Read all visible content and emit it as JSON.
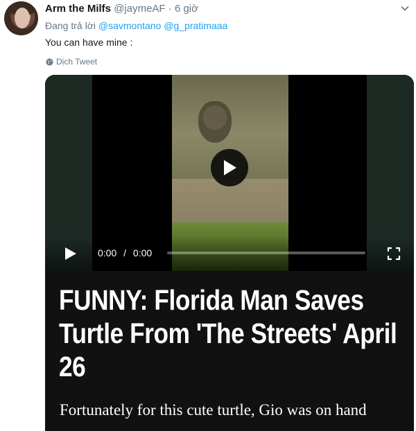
{
  "tweet": {
    "display_name": "Arm the Milfs",
    "handle": "@jaymeAF",
    "separator": "·",
    "time": "6 giờ",
    "reply_prefix": "Đang trả lời",
    "mentions": [
      "@savmontano",
      "@g_pratimaaa"
    ],
    "text": "You can have mine :",
    "translate_label": "Dịch Tweet"
  },
  "video": {
    "timecode_current": "0:00",
    "timecode_separator": "/",
    "timecode_total": "0:00",
    "progress": 0
  },
  "card": {
    "headline": "FUNNY: Florida Man Saves Turtle From 'The Streets' April 26",
    "lede": "Fortunately for this cute turtle, Gio was on hand"
  },
  "colors": {
    "link": "#1da1f2",
    "muted": "#657786",
    "card_bg": "#111111"
  },
  "icons": [
    "chevron-down-icon",
    "globe-icon",
    "play-icon",
    "fullscreen-icon"
  ]
}
